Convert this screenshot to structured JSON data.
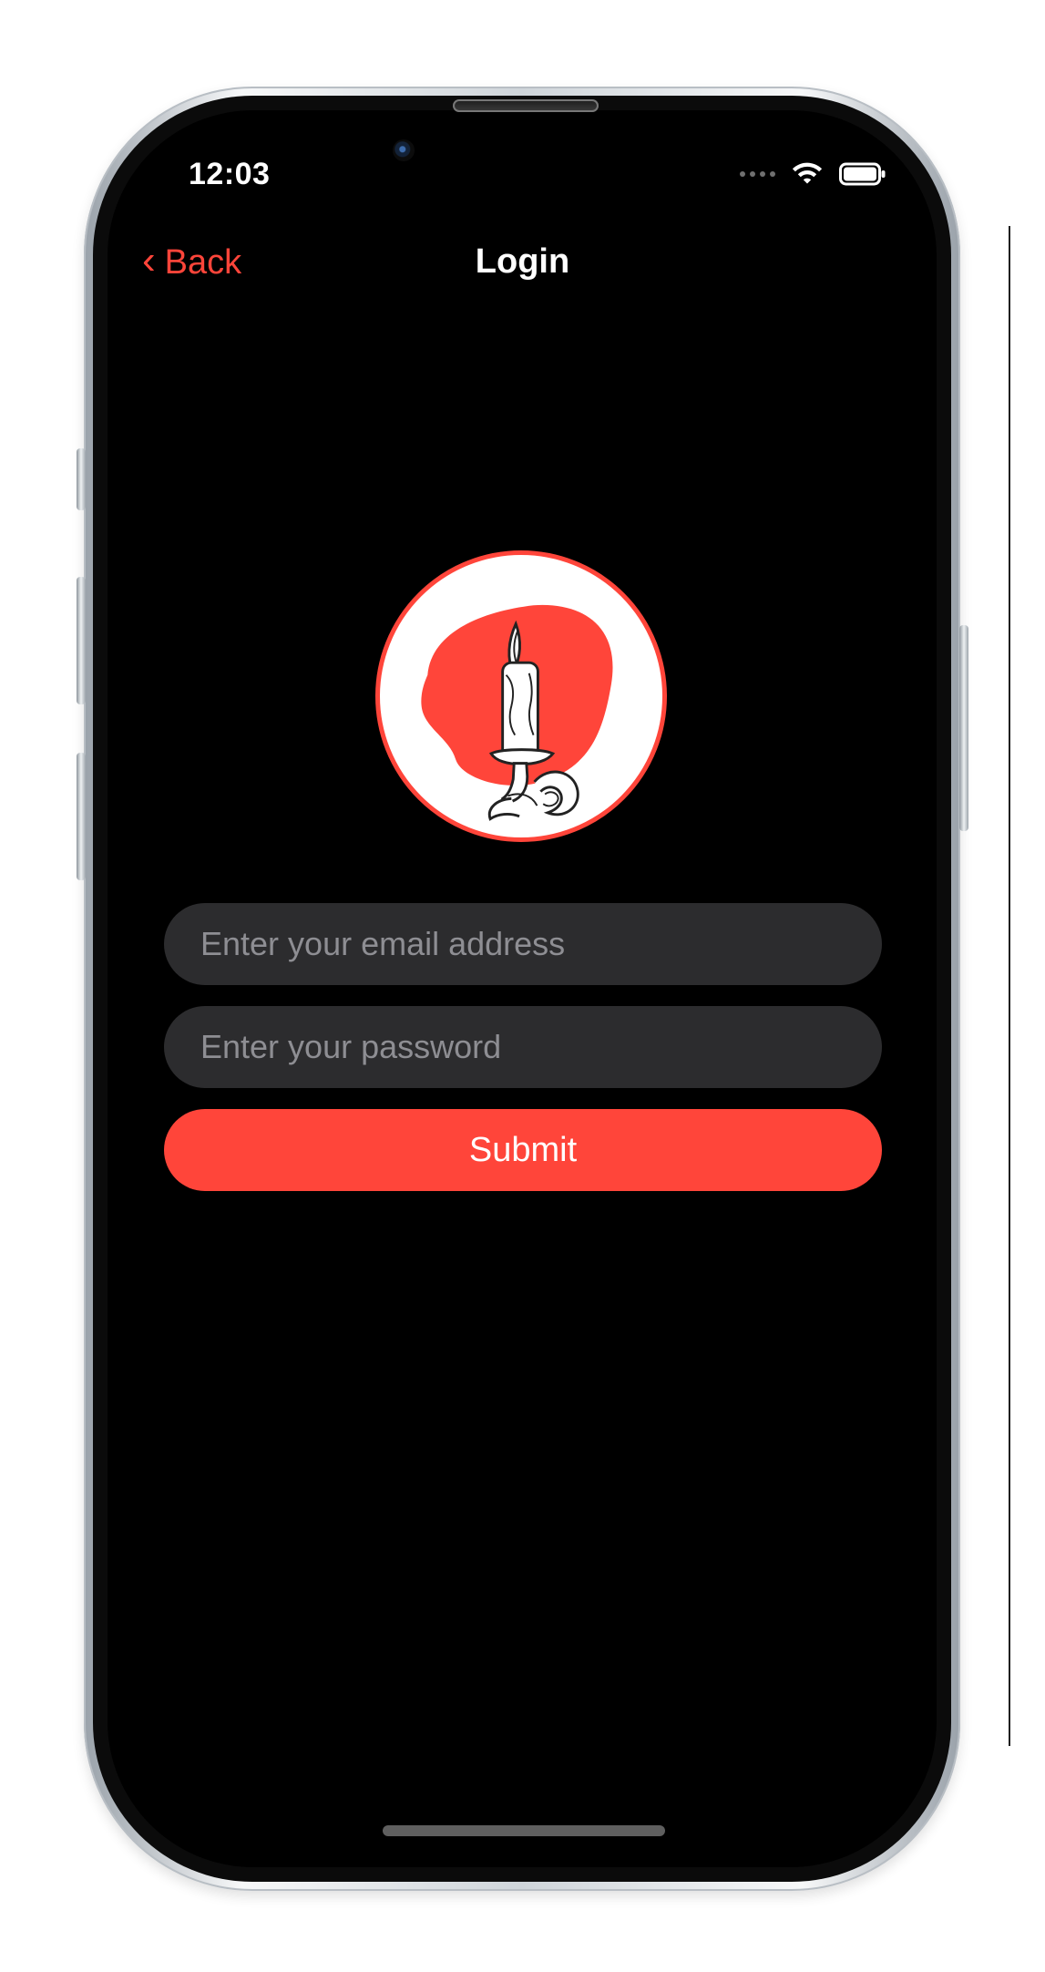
{
  "status_bar": {
    "time": "12:03",
    "icons": [
      "signal-dots-icon",
      "wifi-icon",
      "battery-icon"
    ]
  },
  "navigation": {
    "back_label": "Back",
    "title": "Login"
  },
  "logo": {
    "icon": "candle-logo"
  },
  "form": {
    "email_placeholder": "Enter your email address",
    "password_placeholder": "Enter your password",
    "submit_label": "Submit"
  },
  "colors": {
    "accent": "#ff453a",
    "background": "#000000",
    "field_background": "#2c2c2e",
    "placeholder": "#8e8e93",
    "text": "#ffffff"
  }
}
